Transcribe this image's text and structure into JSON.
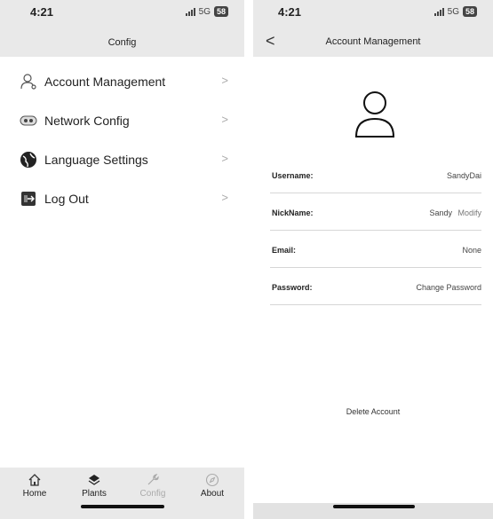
{
  "left": {
    "status": {
      "time": "4:21",
      "network": "5G",
      "battery": "58"
    },
    "title": "Config",
    "menu": [
      {
        "label": "Account Management",
        "icon": "user-settings-icon"
      },
      {
        "label": "Network Config",
        "icon": "network-icon"
      },
      {
        "label": "Language Settings",
        "icon": "globe-icon"
      },
      {
        "label": "Log Out",
        "icon": "logout-icon"
      }
    ],
    "tabs": [
      {
        "label": "Home",
        "icon": "home-icon"
      },
      {
        "label": "Plants",
        "icon": "plants-icon"
      },
      {
        "label": "Config",
        "icon": "wrench-icon"
      },
      {
        "label": "About",
        "icon": "compass-icon"
      }
    ]
  },
  "right": {
    "status": {
      "time": "4:21",
      "network": "5G",
      "battery": "58"
    },
    "title": "Account Management",
    "rows": [
      {
        "key": "Username:",
        "value": "SandyDai"
      },
      {
        "key": "NickName:",
        "value": "Sandy",
        "action": "Modify"
      },
      {
        "key": "Email:",
        "value": "None"
      },
      {
        "key": "Password:",
        "value": "Change Password"
      }
    ],
    "delete_label": "Delete Account"
  },
  "colors": {
    "header_bg": "#e9e9e9",
    "text": "#222222",
    "muted": "#aaaaaa"
  }
}
